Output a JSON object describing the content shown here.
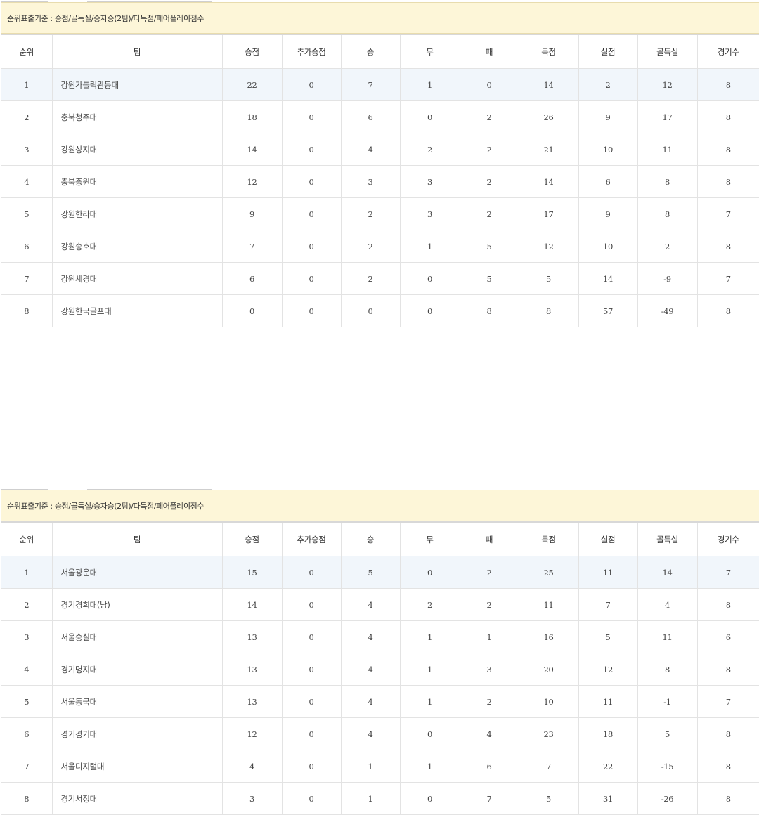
{
  "headers": [
    "순위",
    "팀",
    "승점",
    "추가승점",
    "승",
    "무",
    "패",
    "득점",
    "실점",
    "골득실",
    "경기수"
  ],
  "tables": [
    {
      "criteria": "순위표출기준 : 승점/골득실/승자승(2팀)/다득점/페어플레이점수",
      "rows": [
        [
          "1",
          "강원가톨릭관동대",
          "22",
          "0",
          "7",
          "1",
          "0",
          "14",
          "2",
          "12",
          "8"
        ],
        [
          "2",
          "충북청주대",
          "18",
          "0",
          "6",
          "0",
          "2",
          "26",
          "9",
          "17",
          "8"
        ],
        [
          "3",
          "강원상지대",
          "14",
          "0",
          "4",
          "2",
          "2",
          "21",
          "10",
          "11",
          "8"
        ],
        [
          "4",
          "충북중원대",
          "12",
          "0",
          "3",
          "3",
          "2",
          "14",
          "6",
          "8",
          "8"
        ],
        [
          "5",
          "강원한라대",
          "9",
          "0",
          "2",
          "3",
          "2",
          "17",
          "9",
          "8",
          "7"
        ],
        [
          "6",
          "강원송호대",
          "7",
          "0",
          "2",
          "1",
          "5",
          "12",
          "10",
          "2",
          "8"
        ],
        [
          "7",
          "강원세경대",
          "6",
          "0",
          "2",
          "0",
          "5",
          "5",
          "14",
          "-9",
          "7"
        ],
        [
          "8",
          "강원한국골프대",
          "0",
          "0",
          "0",
          "0",
          "8",
          "8",
          "57",
          "-49",
          "8"
        ]
      ]
    },
    {
      "criteria": "순위표출기준 : 승점/골득실/승자승(2팀)/다득점/페어플레이점수",
      "rows": [
        [
          "1",
          "서울광운대",
          "15",
          "0",
          "5",
          "0",
          "2",
          "25",
          "11",
          "14",
          "7"
        ],
        [
          "2",
          "경기경희대(남)",
          "14",
          "0",
          "4",
          "2",
          "2",
          "11",
          "7",
          "4",
          "8"
        ],
        [
          "3",
          "서울숭실대",
          "13",
          "0",
          "4",
          "1",
          "1",
          "16",
          "5",
          "11",
          "6"
        ],
        [
          "4",
          "경기명지대",
          "13",
          "0",
          "4",
          "1",
          "3",
          "20",
          "12",
          "8",
          "8"
        ],
        [
          "5",
          "서울동국대",
          "13",
          "0",
          "4",
          "1",
          "2",
          "10",
          "11",
          "-1",
          "7"
        ],
        [
          "6",
          "경기경기대",
          "12",
          "0",
          "4",
          "0",
          "4",
          "23",
          "18",
          "5",
          "8"
        ],
        [
          "7",
          "서울디지털대",
          "4",
          "0",
          "1",
          "1",
          "6",
          "7",
          "22",
          "-15",
          "8"
        ],
        [
          "8",
          "경기서정대",
          "3",
          "0",
          "1",
          "0",
          "7",
          "5",
          "31",
          "-26",
          "8"
        ]
      ]
    }
  ]
}
